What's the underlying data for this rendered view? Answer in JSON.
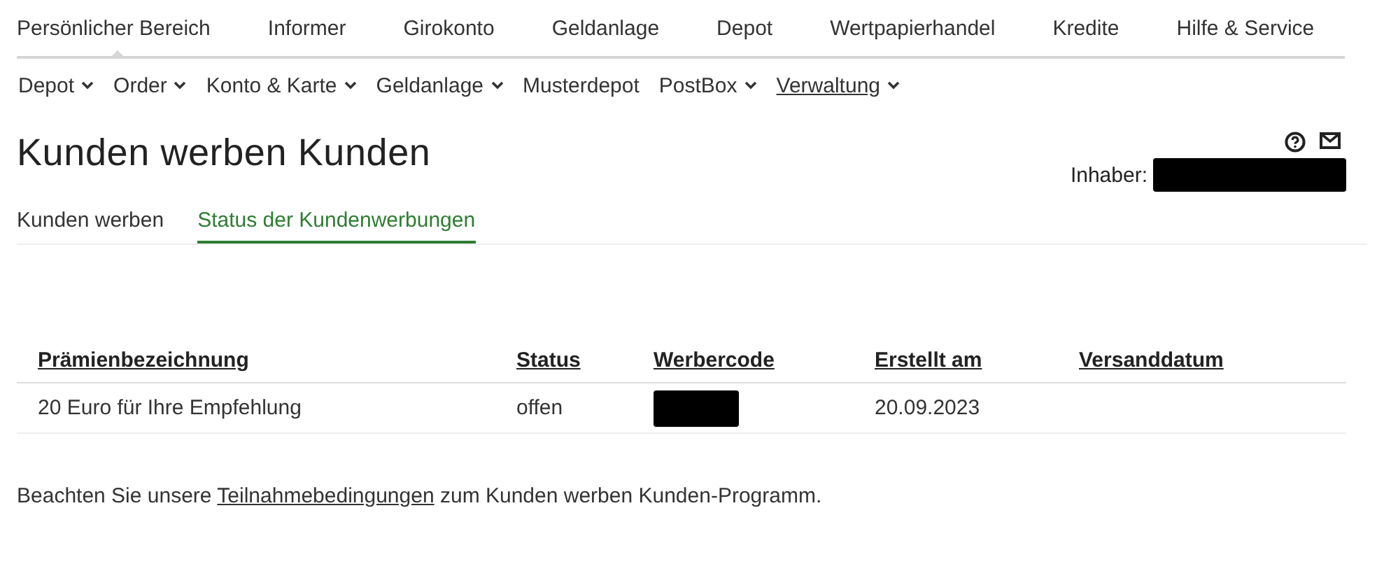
{
  "main_nav": [
    {
      "label": "Persönlicher Bereich",
      "selected": true
    },
    {
      "label": "Informer",
      "selected": false
    },
    {
      "label": "Girokonto",
      "selected": false
    },
    {
      "label": "Geldanlage",
      "selected": false
    },
    {
      "label": "Depot",
      "selected": false
    },
    {
      "label": "Wertpapierhandel",
      "selected": false
    },
    {
      "label": "Kredite",
      "selected": false
    },
    {
      "label": "Hilfe & Service",
      "selected": false
    }
  ],
  "sub_nav": [
    {
      "label": "Depot",
      "has_menu": true,
      "selected": false
    },
    {
      "label": "Order",
      "has_menu": true,
      "selected": false
    },
    {
      "label": "Konto & Karte",
      "has_menu": true,
      "selected": false
    },
    {
      "label": "Geldanlage",
      "has_menu": true,
      "selected": false
    },
    {
      "label": "Musterdepot",
      "has_menu": false,
      "selected": false
    },
    {
      "label": "PostBox",
      "has_menu": true,
      "selected": false
    },
    {
      "label": "Verwaltung",
      "has_menu": true,
      "selected": true
    }
  ],
  "page_title": "Kunden werben Kunden",
  "owner": {
    "label": "Inhaber:",
    "redacted": true
  },
  "tabs": [
    {
      "label": "Kunden werben",
      "selected": false
    },
    {
      "label": "Status der Kundenwerbungen",
      "selected": true
    }
  ],
  "table": {
    "columns": [
      "Prämienbezeichnung",
      "Status",
      "Werbercode",
      "Erstellt am",
      "Versanddatum"
    ],
    "rows": [
      [
        {
          "kind": "text",
          "text": "20 Euro für Ihre Empfehlung"
        },
        {
          "kind": "text",
          "text": "offen"
        },
        {
          "kind": "redacted"
        },
        {
          "kind": "text",
          "text": "20.09.2023"
        },
        {
          "kind": "empty"
        }
      ]
    ]
  },
  "footer_note": {
    "before": "Beachten Sie unsere ",
    "link": "Teilnahmebedingungen",
    "after": " zum Kunden werben Kunden-Programm."
  }
}
